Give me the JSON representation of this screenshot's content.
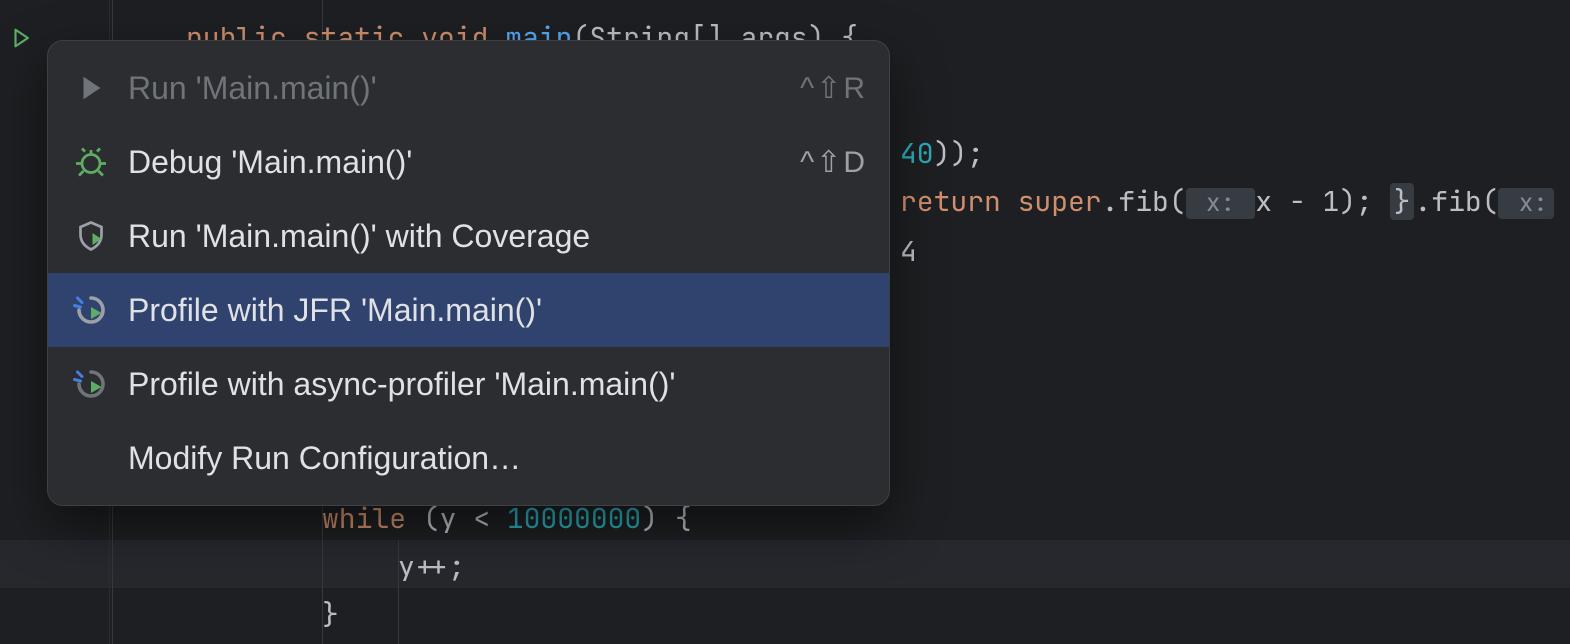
{
  "gutter": {
    "run_icon": "run-triangle"
  },
  "menu": {
    "items": [
      {
        "icon": "play-icon",
        "label": "Run 'Main.main()'",
        "shortcut": "^⇧R",
        "disabled": true,
        "selected": false
      },
      {
        "icon": "bug-icon",
        "label": "Debug 'Main.main()'",
        "shortcut": "^⇧D",
        "disabled": false,
        "selected": false
      },
      {
        "icon": "shield-play-icon",
        "label": "Run 'Main.main()' with Coverage",
        "shortcut": "",
        "disabled": false,
        "selected": false
      },
      {
        "icon": "profile-jfr-icon",
        "label": "Profile with JFR 'Main.main()'",
        "shortcut": "",
        "disabled": false,
        "selected": true
      },
      {
        "icon": "profile-async-icon",
        "label": "Profile with async-profiler 'Main.main()'",
        "shortcut": "",
        "disabled": false,
        "selected": false
      },
      {
        "icon": "blank-icon",
        "label": "Modify Run Configuration…",
        "shortcut": "",
        "disabled": false,
        "selected": false
      }
    ]
  },
  "code": {
    "line1_pre": "public static void ",
    "line1_method": "main",
    "line1_post": "(String[] args) {",
    "line2_num": "40",
    "line2_tail": "));",
    "line3_return": "return ",
    "line3_super": "super",
    "line3_dot": ".fib(",
    "line3_hint1": " x: ",
    "line3_mid": "x - 1); ",
    "line3_brace": "}",
    "line3_tail": ".fib(",
    "line3_hint2": " x: ",
    "line3_last": "4",
    "line7_while": "while",
    "line7_mid": " (y < ",
    "line7_num": "10000000",
    "line7_tail": ") {",
    "line8": "y++;",
    "line9": "}"
  }
}
